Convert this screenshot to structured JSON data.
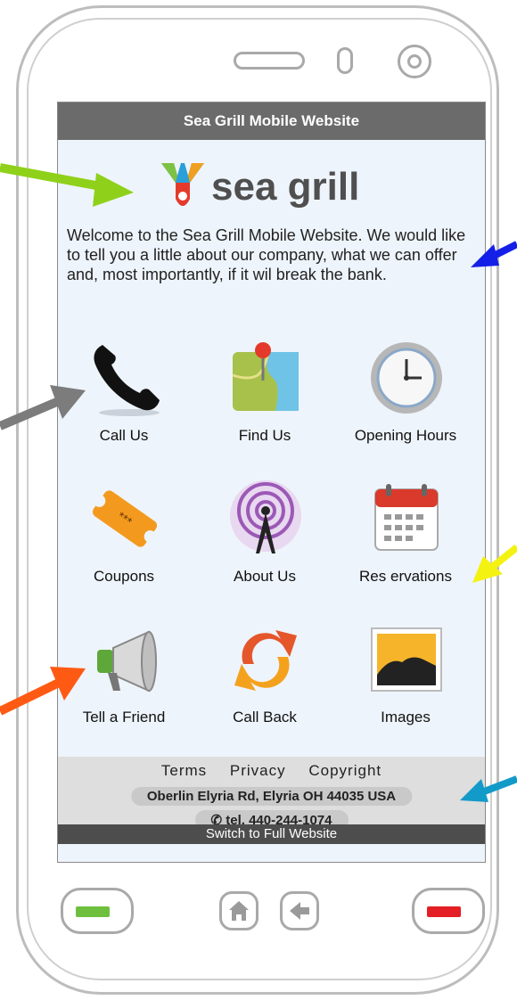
{
  "screen": {
    "title": "Sea Grill Mobile Website",
    "logo_text": "sea grill",
    "intro": "Welcome to the Sea Grill Mobile Website.  We would like to tell you a little about our  company, what we can offer and, most importantly, if it wil break the bank."
  },
  "menu": [
    {
      "label": "Call Us",
      "icon": "phone-icon"
    },
    {
      "label": "Find Us",
      "icon": "map-icon"
    },
    {
      "label": "Opening Hours",
      "icon": "clock-icon"
    },
    {
      "label": "Coupons",
      "icon": "ticket-icon"
    },
    {
      "label": "About Us",
      "icon": "antenna-icon"
    },
    {
      "label": "Res ervations",
      "icon": "calendar-icon"
    },
    {
      "label": "Tell a Friend",
      "icon": "megaphone-icon"
    },
    {
      "label": "Call Back",
      "icon": "refresh-icon"
    },
    {
      "label": "Images",
      "icon": "image-icon"
    }
  ],
  "footer": {
    "links": [
      "Terms",
      "Privacy",
      "Copyright"
    ],
    "address": "Oberlin Elyria Rd, Elyria OH 44035 USA",
    "phone": "tel. 440-244-1074",
    "switch": "Switch to Full Website"
  },
  "colors": {
    "titlebar": "#6b6b6b",
    "screen_bg": "#eef4fb",
    "arrow_green": "#8fd11a",
    "arrow_blue": "#1420e8",
    "arrow_gray": "#7c7c7c",
    "arrow_yellow": "#f4f210",
    "arrow_orange": "#ff5a14",
    "arrow_cyan": "#129ac9",
    "hw_green": "#6fbf3f",
    "hw_red": "#e31e24"
  }
}
